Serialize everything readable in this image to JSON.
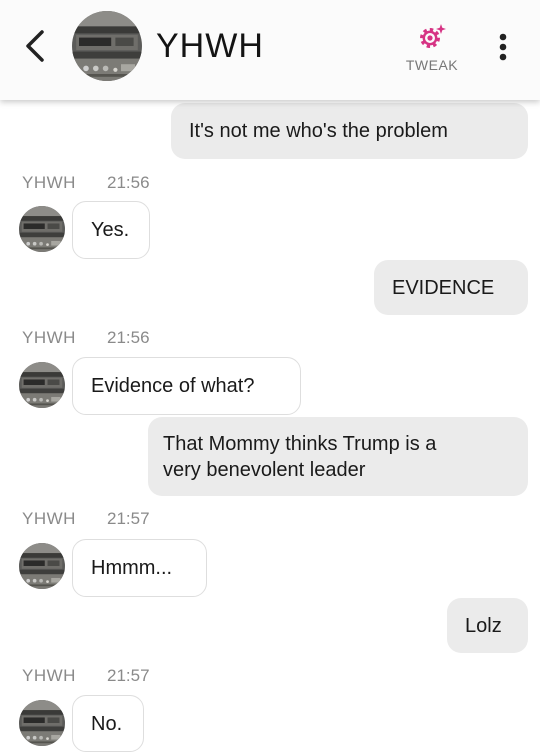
{
  "header": {
    "contact_name": "YHWH",
    "tweak_label": "TWEAK",
    "back_icon": "chevron-left-icon",
    "tweak_icon": "gear-sparkle-icon",
    "menu_icon": "more-vertical-icon",
    "accent_color": "#d63384"
  },
  "messages": [
    {
      "direction": "out",
      "text": "It's not me who's the problem"
    },
    {
      "direction": "in",
      "sender": "YHWH",
      "time": "21:56",
      "text": "Yes."
    },
    {
      "direction": "out",
      "text": "EVIDENCE"
    },
    {
      "direction": "in",
      "sender": "YHWH",
      "time": "21:56",
      "text": "Evidence of what?"
    },
    {
      "direction": "out",
      "text_line1": "That Mommy thinks Trump is a",
      "text_line2": "very benevolent leader"
    },
    {
      "direction": "in",
      "sender": "YHWH",
      "time": "21:57",
      "text": "Hmmm..."
    },
    {
      "direction": "out",
      "text": "Lolz"
    },
    {
      "direction": "in",
      "sender": "YHWH",
      "time": "21:57",
      "text": "No."
    }
  ]
}
